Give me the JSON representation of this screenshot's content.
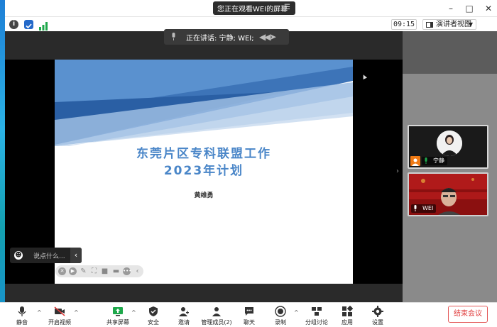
{
  "window": {
    "share_banner": "您正在观看WEI的屏幕",
    "share_menu_glyph": "☰",
    "minimize": "–",
    "maximize": "□",
    "close": "✕"
  },
  "status": {
    "timer": "09:15",
    "view_mode": "演讲者视图"
  },
  "speaking": {
    "label": "正在讲话: 宁静; WEI;"
  },
  "slide": {
    "title_line1": "东莞片区专科联盟工作",
    "title_line2": "2023年计划",
    "author": "黄维勇",
    "colors": {
      "title": "#4a86c8",
      "band_dark": "#3d74b8",
      "band_light": "#b9d0ea"
    }
  },
  "chat": {
    "placeholder": "说点什么..."
  },
  "participants": [
    {
      "name": "宁静",
      "video_on": true
    },
    {
      "name": "WEI",
      "video_on": true
    }
  ],
  "toolbar": {
    "mute": "静音",
    "start_video": "开启视频",
    "share_screen": "共享屏幕",
    "security": "安全",
    "invite": "邀请",
    "participants": "管理成员(2)",
    "chat": "聊天",
    "record": "录制",
    "breakout": "分组讨论",
    "apps": "应用",
    "settings": "设置",
    "end_meeting": "结束会议"
  },
  "colors": {
    "accent_green": "#1ea84b",
    "end_red": "#e03c3c",
    "speaker_tile_bg": "#8b1010"
  }
}
